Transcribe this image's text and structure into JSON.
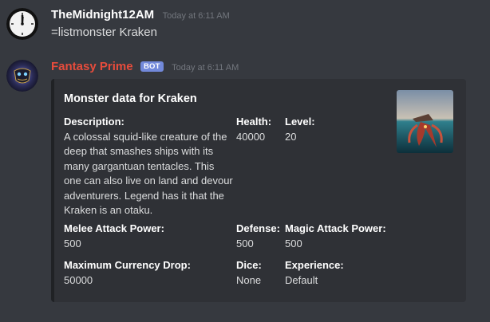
{
  "messages": [
    {
      "author": "TheMidnight12AM",
      "timestamp": "Today at 6:11 AM",
      "text": "=listmonster Kraken",
      "avatar_icon": "clock-avatar"
    },
    {
      "author": "Fantasy Prime",
      "author_color": "#e74c3c",
      "bot_tag": "BOT",
      "timestamp": "Today at 6:11 AM",
      "avatar_icon": "mask-avatar"
    }
  ],
  "embed": {
    "title": "Monster data for Kraken",
    "thumbnail_icon": "kraken-image",
    "fields": {
      "description": {
        "name": "Description:",
        "value": "A colossal squid-like creature of the deep that smashes ships with its many gargantuan tentacles. This one can also live on land and devour adventurers. Legend has it that the Kraken is an otaku."
      },
      "health": {
        "name": "Health:",
        "value": "40000"
      },
      "level": {
        "name": "Level:",
        "value": "20"
      },
      "melee": {
        "name": "Melee Attack Power:",
        "value": "500"
      },
      "defense": {
        "name": "Defense:",
        "value": "500"
      },
      "magic": {
        "name": "Magic Attack Power:",
        "value": "500"
      },
      "currency": {
        "name": "Maximum Currency Drop:",
        "value": "50000"
      },
      "dice": {
        "name": "Dice:",
        "value": "None"
      },
      "experience": {
        "name": "Experience:",
        "value": "Default"
      }
    }
  }
}
